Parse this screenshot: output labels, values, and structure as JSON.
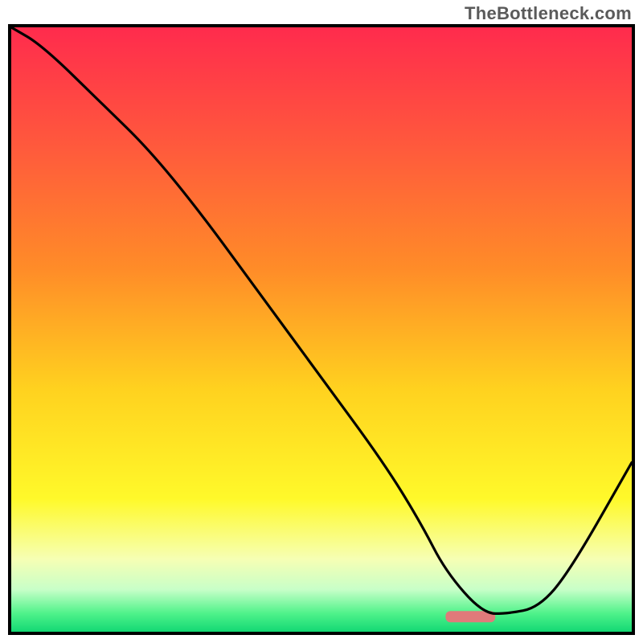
{
  "watermark": "TheBottleneck.com",
  "chart_data": {
    "type": "line",
    "title": "",
    "xlabel": "",
    "ylabel": "",
    "xlim": [
      0,
      100
    ],
    "ylim": [
      0,
      100
    ],
    "grid": false,
    "legend": false,
    "series": [
      {
        "name": "curve",
        "color": "#000000",
        "x": [
          0,
          5,
          15,
          22,
          30,
          40,
          50,
          60,
          66,
          70,
          76,
          80,
          85,
          90,
          100
        ],
        "y": [
          100,
          97,
          87,
          80,
          70,
          56,
          42,
          28,
          18,
          10,
          3,
          3,
          4,
          10,
          28
        ]
      }
    ],
    "optimal_marker": {
      "x_start": 70,
      "x_end": 78,
      "y": 2.5,
      "color": "#e07a7a"
    },
    "background_gradient": {
      "stops": [
        {
          "offset": 0.0,
          "color": "#ff2b4d"
        },
        {
          "offset": 0.2,
          "color": "#ff5a3c"
        },
        {
          "offset": 0.4,
          "color": "#ff8c28"
        },
        {
          "offset": 0.6,
          "color": "#ffd21f"
        },
        {
          "offset": 0.78,
          "color": "#fff92a"
        },
        {
          "offset": 0.88,
          "color": "#f6ffb4"
        },
        {
          "offset": 0.93,
          "color": "#c8ffc8"
        },
        {
          "offset": 0.97,
          "color": "#4ef28a"
        },
        {
          "offset": 1.0,
          "color": "#13d874"
        }
      ]
    }
  }
}
